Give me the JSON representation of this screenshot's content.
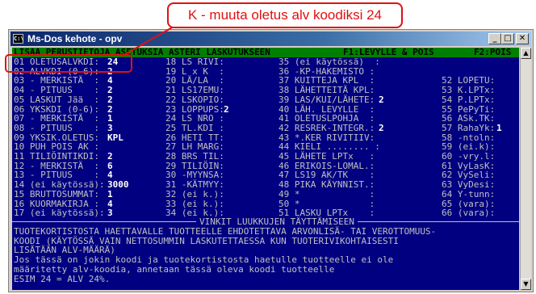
{
  "callout": {
    "text": "K - muuta oletus alv koodiksi 24"
  },
  "window": {
    "title": "Ms-Dos kehote - opv",
    "icon_text": "C:\\"
  },
  "header": {
    "title": "LISÄÄ PERUSTIETOJA ASETUKSIA ASTERI LASKUTUKSEEN",
    "f1": "F1:LEVYLLE & POIS",
    "f2": "F2:POIS"
  },
  "settings": {
    "col1": [
      {
        "label": "01 OLETUSALVKDI:",
        "value": "24"
      },
      {
        "label": "02 ALVKDI (0-6):",
        "value": "2"
      },
      {
        "label": "03 - MERKISTÄ  :",
        "value": "4"
      },
      {
        "label": "04 - PITUUS    :",
        "value": "2"
      },
      {
        "label": "05 LASKUT Jää  :",
        "value": "2"
      },
      {
        "label": "06 YKSKDI (0-6):",
        "value": "2"
      },
      {
        "label": "07 - MERKISTÄ  :",
        "value": "1"
      },
      {
        "label": "08 - PITUUS    :",
        "value": "3"
      },
      {
        "label": "09 YKSIK.OLETUS:",
        "value": "KPL"
      },
      {
        "label": "10 PUH POIS AK :",
        "value": ""
      },
      {
        "label": "11 TILIÖINTIKDI:",
        "value": "2"
      },
      {
        "label": "12 - MERKISTÄ  :",
        "value": "6"
      },
      {
        "label": "13 - PITUUS    :",
        "value": "4"
      },
      {
        "label": "14 (ei käytössä):",
        "value": "3000"
      },
      {
        "label": "15 BRUTTOSUMMAT:",
        "value": "1"
      },
      {
        "label": "16 KUORMAKIRJA :",
        "value": "4"
      },
      {
        "label": "17 (ei käytössä):",
        "value": "3"
      }
    ],
    "col2": [
      {
        "label": "18 LS RIVI:",
        "value": ""
      },
      {
        "label": "19 L x K  :",
        "value": ""
      },
      {
        "label": "20 LÄ/LA  :",
        "value": ""
      },
      {
        "label": "21 LS17EMU:",
        "value": ""
      },
      {
        "label": "22 LSKOPIO:",
        "value": ""
      },
      {
        "label": "23 LOPPUPS:",
        "value": "2"
      },
      {
        "label": "24 LS NRO :",
        "value": ""
      },
      {
        "label": "25 TL.KDI :",
        "value": ""
      },
      {
        "label": "26 HETI TT:",
        "value": ""
      },
      {
        "label": "27 LH MARG:",
        "value": ""
      },
      {
        "label": "28 BRS TIL:",
        "value": ""
      },
      {
        "label": "29 TILIÖIN:",
        "value": ""
      },
      {
        "label": "30 -MYYNSA:",
        "value": ""
      },
      {
        "label": "31 -KÄTMYY:",
        "value": ""
      },
      {
        "label": "32 (ei k.):",
        "value": ""
      },
      {
        "label": "33 (ei k.):",
        "value": ""
      },
      {
        "label": "34 (ei k.):",
        "value": ""
      }
    ],
    "col3": [
      {
        "label": "35 (ei käytössä)  :",
        "value": ""
      },
      {
        "label": "36 -KP-HAKEMISTO :",
        "value": ""
      },
      {
        "label": "37 KUITTEJA KPL  :",
        "value": ""
      },
      {
        "label": "38 LÄHETTEITÄ KPL:",
        "value": ""
      },
      {
        "label": "39 LAS/KUI/LÄHETE:",
        "value": "2"
      },
      {
        "label": "40 LÄH. LEVYLLE  :",
        "value": ""
      },
      {
        "label": "41 OLETUSLPOHJA  :",
        "value": ""
      },
      {
        "label": "42 RESREK-INTEGR.:",
        "value": "2"
      },
      {
        "label": "43 *.KER RIVITIIV:",
        "value": ""
      },
      {
        "label": "44 KIELI ........ :",
        "value": ""
      },
      {
        "label": "45 LÄHETE LPTx   :",
        "value": ""
      },
      {
        "label": "46 ERIKOIS-LOMAL.:",
        "value": ""
      },
      {
        "label": "47 LS19 AK/TK    :",
        "value": ""
      },
      {
        "label": "48 PIKA KÄYNNIST.:",
        "value": ""
      },
      {
        "label": "49 *             :",
        "value": ""
      },
      {
        "label": "50 *             :",
        "value": ""
      },
      {
        "label": "51 LASKU LPTx    :",
        "value": ""
      }
    ],
    "col4": [
      {
        "label": "",
        "value": ""
      },
      {
        "label": "",
        "value": ""
      },
      {
        "label": "52 LOPETU:",
        "value": ""
      },
      {
        "label": "53 K.LPTx:",
        "value": ""
      },
      {
        "label": "54 P.LPTx:",
        "value": ""
      },
      {
        "label": "55 PePyTi:",
        "value": ""
      },
      {
        "label": "56 ASk.TK:",
        "value": ""
      },
      {
        "label": "57 RahaYk:",
        "value": "1"
      },
      {
        "label": "58 -ntoln:",
        "value": ""
      },
      {
        "label": "59 (ei.k):",
        "value": ""
      },
      {
        "label": "60 -vry.l:",
        "value": ""
      },
      {
        "label": "61 VyLasK:",
        "value": ""
      },
      {
        "label": "62 VySeli:",
        "value": ""
      },
      {
        "label": "63 VyDesi:",
        "value": ""
      },
      {
        "label": "64 Y-tunn:",
        "value": ""
      },
      {
        "label": "65 (vara):",
        "value": ""
      },
      {
        "label": "66 (vara):",
        "value": ""
      }
    ]
  },
  "hints": {
    "title": "VINKIT LUUKKUJEN TÄYTTÄMISEEN",
    "lines": [
      "TUOTEKORTISTOSTA HAETTAVALLE TUOTTEELLE EHDOTETTAVA ARVONLISÄ- TAI VEROTTOMUUS-",
      "KOODI (KÄYTÖSSÄ VAIN NETTOSUMMIN LASKUTETTAESSA KUN TUOTERIVIKOHTAISESTI",
      "LISÄTÄÄN ALV-MÄÄRÄ)",
      "Jos tässä on jokin koodi ja tuotekortistosta haetulle tuotteelle ei ole",
      "määritetty alv-koodia, annetaan tässä oleva koodi tuotteelle",
      "ESIM 24 = ALV 24%."
    ]
  },
  "colors": {
    "screen_bg": "#000080",
    "text": "#c0c0c0",
    "highlight": "#ffffff",
    "header_bg": "#008000",
    "callout": "#e01010"
  }
}
